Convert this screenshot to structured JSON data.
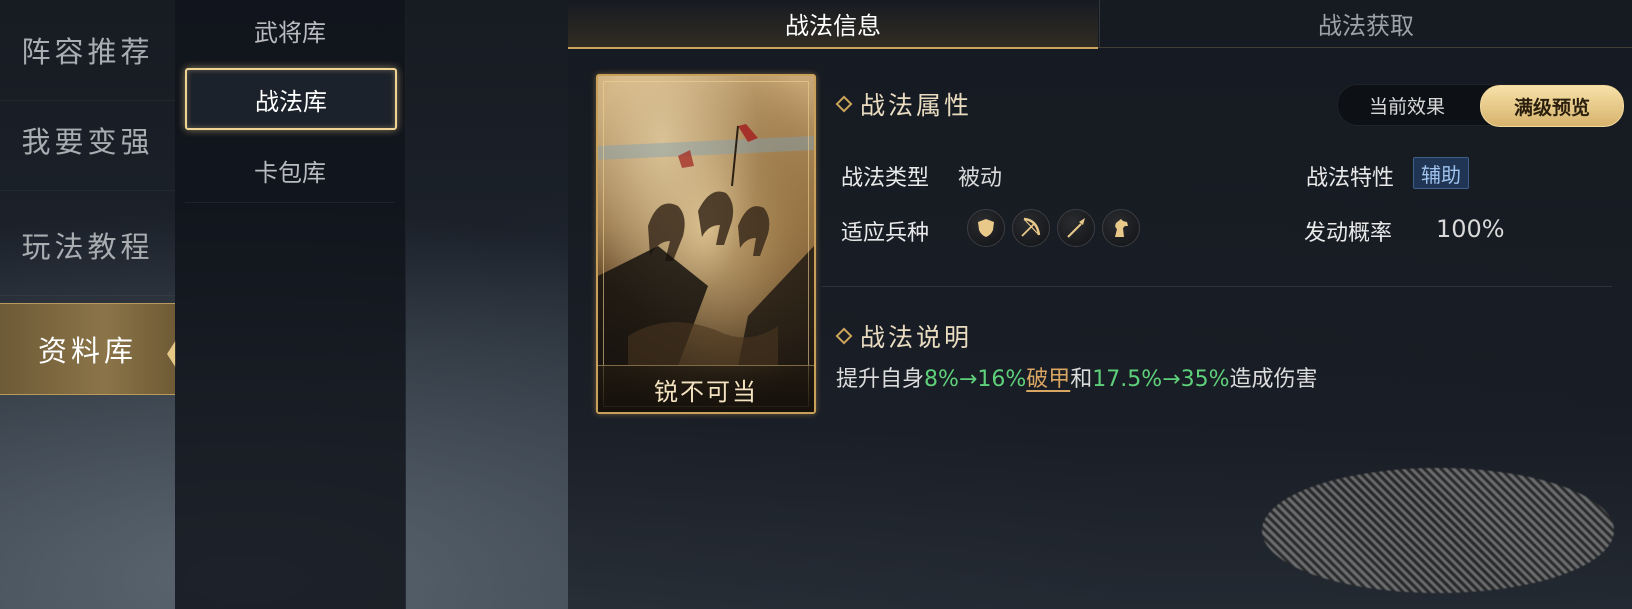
{
  "left_nav": {
    "items": [
      {
        "label": "阵容推荐"
      },
      {
        "label": "我要变强"
      },
      {
        "label": "玩法教程"
      },
      {
        "label": "资料库"
      }
    ],
    "active_index": 3
  },
  "sub_nav": {
    "items": [
      {
        "label": "武将库"
      },
      {
        "label": "战法库"
      },
      {
        "label": "卡包库"
      }
    ],
    "active_index": 1
  },
  "tabs": [
    {
      "label": "战法信息"
    },
    {
      "label": "战法获取"
    }
  ],
  "active_tab": 0,
  "card": {
    "name": "锐不可当"
  },
  "toggle": {
    "current": "当前效果",
    "max_preview": "满级预览",
    "selected": "满级预览"
  },
  "attributes": {
    "header": "战法属性",
    "type_label": "战法类型",
    "type_value": "被动",
    "trait_label": "战法特性",
    "trait_value": "辅助",
    "troop_label": "适应兵种",
    "troops": [
      "shield-icon",
      "bow-icon",
      "spear-icon",
      "horse-icon"
    ],
    "rate_label": "发动概率",
    "rate_value": "100%"
  },
  "description": {
    "header": "战法说明",
    "text_1": "提升自身",
    "value_1": "8%→16%",
    "keyword": "破甲",
    "text_2": "和",
    "value_2": "17.5%→35%",
    "text_3": "造成伤害"
  },
  "colors": {
    "accent_gold": "#c9a45c",
    "value_green": "#5fd07a",
    "tag_blue": "#9fc3ee"
  }
}
